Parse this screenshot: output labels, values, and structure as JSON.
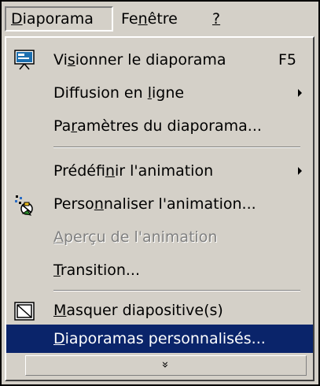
{
  "menubar": {
    "items": [
      {
        "label": "Diaporama",
        "mnemonic": "D",
        "active": true
      },
      {
        "label": "Fenêtre",
        "mnemonic": "n"
      },
      {
        "label": "?",
        "mnemonic": "?"
      }
    ]
  },
  "dropdown": {
    "items": [
      {
        "label": "Visionner le diaporama",
        "mnemonic": "s",
        "shortcut": "F5",
        "icon": "slideshow-screen-icon"
      },
      {
        "label": "Diffusion en ligne",
        "mnemonic": "l",
        "submenu": true
      },
      {
        "label": "Paramètres du diaporama...",
        "mnemonic": "r"
      },
      {
        "label": "Prédéfinir l'animation",
        "mnemonic": "n",
        "submenu": true
      },
      {
        "label": "Personnaliser l'animation...",
        "mnemonic": "n",
        "icon": "custom-animation-icon"
      },
      {
        "label": "Aperçu de l'animation",
        "mnemonic": "A",
        "disabled": true
      },
      {
        "label": "Transition...",
        "mnemonic": "T"
      },
      {
        "label": "Masquer diapositive(s)",
        "mnemonic": "M",
        "icon": "hide-slide-icon"
      },
      {
        "label": "Diaporamas personnalisés...",
        "mnemonic": "D",
        "highlighted": true
      }
    ],
    "expand_label": "»"
  },
  "colors": {
    "face": "#d4d0c8",
    "highlight": "#0a246a",
    "disabled": "#808080"
  }
}
